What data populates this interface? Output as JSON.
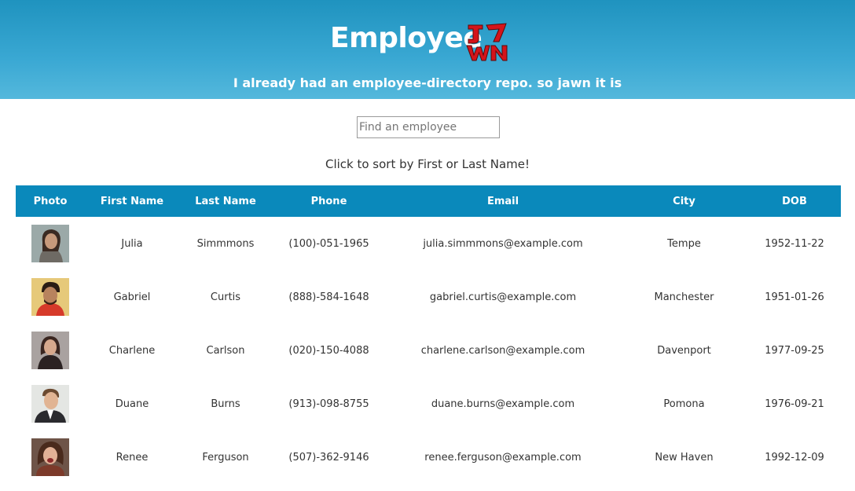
{
  "header": {
    "title": "Employee",
    "subtitle": "I already had an employee-directory repo. so jawn it is",
    "logo_text": "JAWN"
  },
  "search": {
    "placeholder": "Find an employee",
    "value": ""
  },
  "hint": "Click to sort by First or Last Name!",
  "table": {
    "columns": [
      "Photo",
      "First Name",
      "Last Name",
      "Phone",
      "Email",
      "City",
      "DOB"
    ],
    "rows": [
      {
        "first": "Julia",
        "last": "Simmmons",
        "phone": "(100)-051-1965",
        "email": "julia.simmmons@example.com",
        "city": "Tempe",
        "dob": "1952-11-22"
      },
      {
        "first": "Gabriel",
        "last": "Curtis",
        "phone": "(888)-584-1648",
        "email": "gabriel.curtis@example.com",
        "city": "Manchester",
        "dob": "1951-01-26"
      },
      {
        "first": "Charlene",
        "last": "Carlson",
        "phone": "(020)-150-4088",
        "email": "charlene.carlson@example.com",
        "city": "Davenport",
        "dob": "1977-09-25"
      },
      {
        "first": "Duane",
        "last": "Burns",
        "phone": "(913)-098-8755",
        "email": "duane.burns@example.com",
        "city": "Pomona",
        "dob": "1976-09-21"
      },
      {
        "first": "Renee",
        "last": "Ferguson",
        "phone": "(507)-362-9146",
        "email": "renee.ferguson@example.com",
        "city": "New Haven",
        "dob": "1992-12-09"
      }
    ]
  },
  "colors": {
    "header_gradient_top": "#1f93bf",
    "header_gradient_bottom": "#54b8dc",
    "table_header": "#0a89bb",
    "logo_red": "#d4141b"
  }
}
